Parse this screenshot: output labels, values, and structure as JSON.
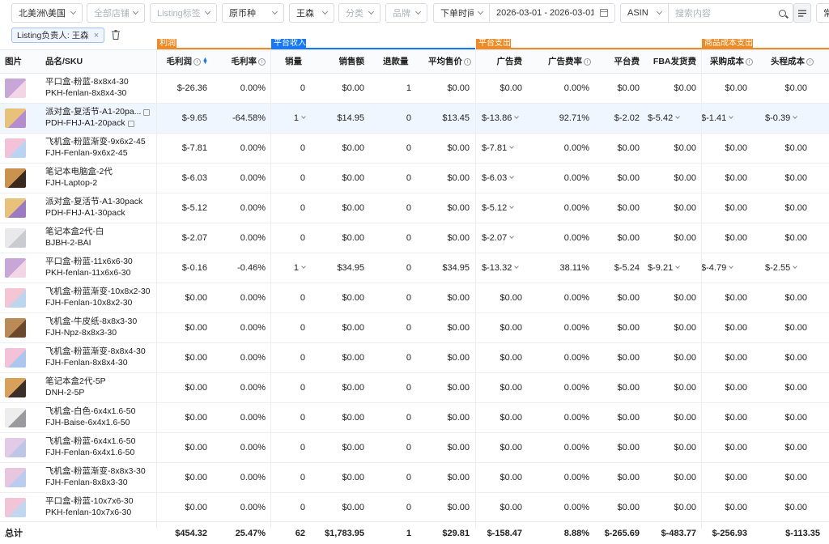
{
  "filters": {
    "region": "北美洲\\美国",
    "store": "全部店铺",
    "listing_tag": "Listing标签",
    "currency": "原币种",
    "owner": "王森",
    "category": "分类",
    "brand": "品牌",
    "time_type": "下单时间",
    "date_range": "2026-03-01 - 2026-03-01",
    "search_field": "ASIN",
    "search_placeholder": "搜索内容",
    "more": "常"
  },
  "chips": {
    "owner_chip": "Listing负责人: 王森",
    "remove": "×"
  },
  "groups": {
    "profit": "利润",
    "platform_income": "平台收入",
    "platform_expense": "平台支出",
    "product_cost": "商品成本支出"
  },
  "columns": {
    "image": "图片",
    "name_sku": "品名/SKU",
    "gross_profit": "毛利润",
    "gross_margin": "毛利率",
    "sales_qty": "销量",
    "sales_amount": "销售额",
    "refund_qty": "退款量",
    "avg_price": "平均售价",
    "ad_cost": "广告费",
    "ad_rate": "广告费率",
    "platform_fee": "平台费",
    "fba_fee": "FBA发货费",
    "purchase_cost": "采购成本",
    "freight_cost": "头程成本"
  },
  "colors": {
    "orange": "#f08a24",
    "blue": "#1677ff",
    "row_highlight": "#f0f6ff"
  },
  "rows": [
    {
      "name": "平口盒-粉蓝-8x8x4-30",
      "sku": "PKH-fenlan-8x8x4-30",
      "gp": "$-26.36",
      "gm": "0.00%",
      "qty": "0",
      "sales": "$0.00",
      "refund": "1",
      "avg": "$0.00",
      "ad": "$0.00",
      "adr": "0.00%",
      "pf": "$0.00",
      "fba": "$0.00",
      "pc": "$0.00",
      "fc": "$0.00"
    },
    {
      "name": "派对盒-复活节-A1-20pa...",
      "sku": "PDH-FHJ-A1-20pack",
      "gp": "$-9.65",
      "gm": "-64.58%",
      "qty": "1",
      "sales": "$14.95",
      "refund": "0",
      "avg": "$13.45",
      "ad": "$-13.86",
      "adr": "92.71%",
      "pf": "$-2.02",
      "fba": "$-5.42",
      "pc": "$-1.41",
      "fc": "$-0.39"
    },
    {
      "name": "飞机盒-粉蓝渐变-9x6x2-45",
      "sku": "FJH-Fenlan-9x6x2-45",
      "gp": "$-7.81",
      "gm": "0.00%",
      "qty": "0",
      "sales": "$0.00",
      "refund": "0",
      "avg": "$0.00",
      "ad": "$-7.81",
      "adr": "0.00%",
      "pf": "$0.00",
      "fba": "$0.00",
      "pc": "$0.00",
      "fc": "$0.00"
    },
    {
      "name": "笔记本电脑盒-2代",
      "sku": "FJH-Laptop-2",
      "gp": "$-6.03",
      "gm": "0.00%",
      "qty": "0",
      "sales": "$0.00",
      "refund": "0",
      "avg": "$0.00",
      "ad": "$-6.03",
      "adr": "0.00%",
      "pf": "$0.00",
      "fba": "$0.00",
      "pc": "$0.00",
      "fc": "$0.00"
    },
    {
      "name": "派对盒-复活节-A1-30pack",
      "sku": "PDH-FHJ-A1-30pack",
      "gp": "$-5.12",
      "gm": "0.00%",
      "qty": "0",
      "sales": "$0.00",
      "refund": "0",
      "avg": "$0.00",
      "ad": "$-5.12",
      "adr": "0.00%",
      "pf": "$0.00",
      "fba": "$0.00",
      "pc": "$0.00",
      "fc": "$0.00"
    },
    {
      "name": "笔记本盒2代-白",
      "sku": "BJBH-2-BAI",
      "gp": "$-2.07",
      "gm": "0.00%",
      "qty": "0",
      "sales": "$0.00",
      "refund": "0",
      "avg": "$0.00",
      "ad": "$-2.07",
      "adr": "0.00%",
      "pf": "$0.00",
      "fba": "$0.00",
      "pc": "$0.00",
      "fc": "$0.00"
    },
    {
      "name": "平口盒-粉蓝-11x6x6-30",
      "sku": "PKH-fenlan-11x6x6-30",
      "gp": "$-0.16",
      "gm": "-0.46%",
      "qty": "1",
      "sales": "$34.95",
      "refund": "0",
      "avg": "$34.95",
      "ad": "$-13.32",
      "adr": "38.11%",
      "pf": "$-5.24",
      "fba": "$-9.21",
      "pc": "$-4.79",
      "fc": "$-2.55"
    },
    {
      "name": "飞机盒-粉蓝渐变-10x8x2-30",
      "sku": "FJH-Fenlan-10x8x2-30",
      "gp": "$0.00",
      "gm": "0.00%",
      "qty": "0",
      "sales": "$0.00",
      "refund": "0",
      "avg": "$0.00",
      "ad": "$0.00",
      "adr": "0.00%",
      "pf": "$0.00",
      "fba": "$0.00",
      "pc": "$0.00",
      "fc": "$0.00"
    },
    {
      "name": "飞机盒-牛皮纸-8x8x3-30",
      "sku": "FJH-Npz-8x8x3-30",
      "gp": "$0.00",
      "gm": "0.00%",
      "qty": "0",
      "sales": "$0.00",
      "refund": "0",
      "avg": "$0.00",
      "ad": "$0.00",
      "adr": "0.00%",
      "pf": "$0.00",
      "fba": "$0.00",
      "pc": "$0.00",
      "fc": "$0.00"
    },
    {
      "name": "飞机盒-粉蓝渐变-8x8x4-30",
      "sku": "FJH-Fenlan-8x8x4-30",
      "gp": "$0.00",
      "gm": "0.00%",
      "qty": "0",
      "sales": "$0.00",
      "refund": "0",
      "avg": "$0.00",
      "ad": "$0.00",
      "adr": "0.00%",
      "pf": "$0.00",
      "fba": "$0.00",
      "pc": "$0.00",
      "fc": "$0.00"
    },
    {
      "name": "笔记本盒2代-5P",
      "sku": "DNH-2-5P",
      "gp": "$0.00",
      "gm": "0.00%",
      "qty": "0",
      "sales": "$0.00",
      "refund": "0",
      "avg": "$0.00",
      "ad": "$0.00",
      "adr": "0.00%",
      "pf": "$0.00",
      "fba": "$0.00",
      "pc": "$0.00",
      "fc": "$0.00"
    },
    {
      "name": "飞机盒-白色-6x4x1.6-50",
      "sku": "FJH-Baise-6x4x1.6-50",
      "gp": "$0.00",
      "gm": "0.00%",
      "qty": "0",
      "sales": "$0.00",
      "refund": "0",
      "avg": "$0.00",
      "ad": "$0.00",
      "adr": "0.00%",
      "pf": "$0.00",
      "fba": "$0.00",
      "pc": "$0.00",
      "fc": "$0.00"
    },
    {
      "name": "飞机盒-粉蓝-6x4x1.6-50",
      "sku": "FJH-Fenlan-6x4x1.6-50",
      "gp": "$0.00",
      "gm": "0.00%",
      "qty": "0",
      "sales": "$0.00",
      "refund": "0",
      "avg": "$0.00",
      "ad": "$0.00",
      "adr": "0.00%",
      "pf": "$0.00",
      "fba": "$0.00",
      "pc": "$0.00",
      "fc": "$0.00"
    },
    {
      "name": "飞机盒-粉蓝渐变-8x8x3-30",
      "sku": "FJH-Fenlan-8x8x3-30",
      "gp": "$0.00",
      "gm": "0.00%",
      "qty": "0",
      "sales": "$0.00",
      "refund": "0",
      "avg": "$0.00",
      "ad": "$0.00",
      "adr": "0.00%",
      "pf": "$0.00",
      "fba": "$0.00",
      "pc": "$0.00",
      "fc": "$0.00"
    },
    {
      "name": "平口盒-粉蓝-10x7x6-30",
      "sku": "PKH-fenlan-10x7x6-30",
      "gp": "$0.00",
      "gm": "0.00%",
      "qty": "0",
      "sales": "$0.00",
      "refund": "0",
      "avg": "$0.00",
      "ad": "$0.00",
      "adr": "0.00%",
      "pf": "$0.00",
      "fba": "$0.00",
      "pc": "$0.00",
      "fc": "$0.00"
    }
  ],
  "totals": {
    "label": "总计",
    "gp": "$454.32",
    "gm": "25.47%",
    "qty": "62",
    "sales": "$1,783.95",
    "refund": "1",
    "avg": "$29.81",
    "ad": "$-158.47",
    "adr": "8.88%",
    "pf": "$-265.69",
    "fba": "$-483.77",
    "pc": "$-256.93",
    "fc": "$-113.35"
  }
}
